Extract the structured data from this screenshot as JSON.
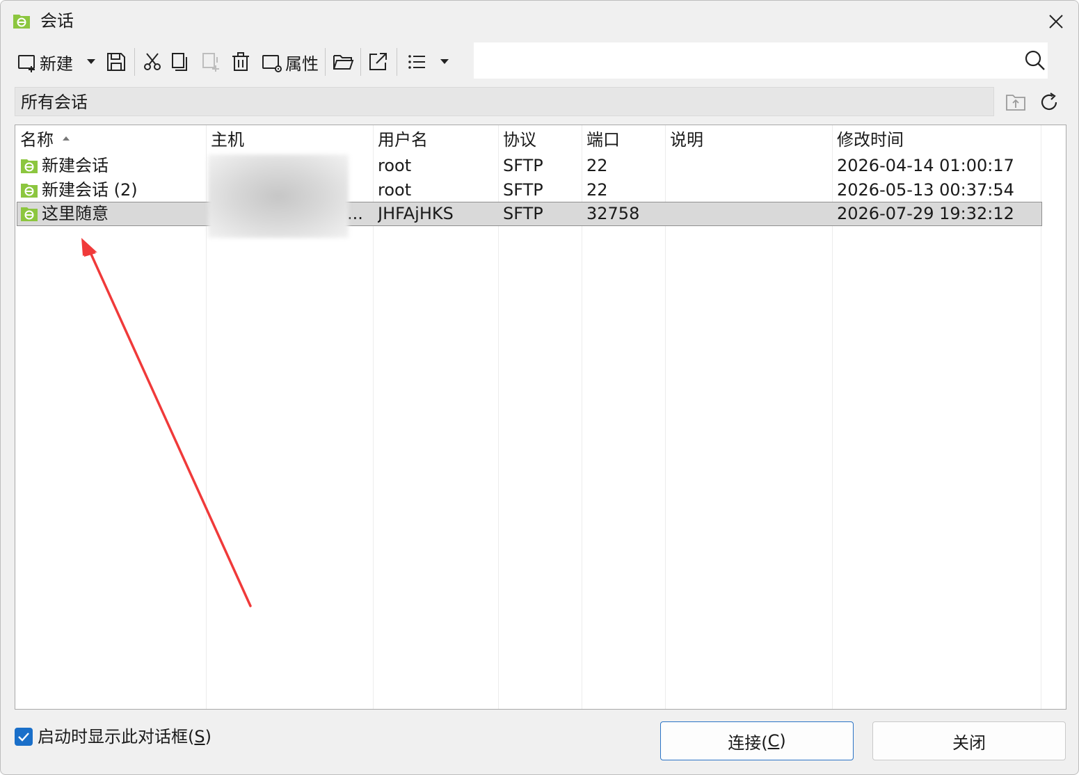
{
  "window": {
    "title": "会话"
  },
  "toolbar": {
    "new_label": "新建",
    "properties_label": "属性",
    "search_value": ""
  },
  "path": {
    "label": "所有会话"
  },
  "table": {
    "columns": [
      "名称",
      "主机",
      "用户名",
      "协议",
      "端口",
      "说明",
      "修改时间"
    ],
    "rows": [
      {
        "name": "新建会话",
        "host": "",
        "user": "root",
        "protocol": "SFTP",
        "port": "22",
        "desc": "",
        "modified": "2026-04-14 01:00:17"
      },
      {
        "name": "新建会话 (2)",
        "host": "",
        "user": "root",
        "protocol": "SFTP",
        "port": "22",
        "desc": "",
        "modified": "2026-05-13 00:37:54"
      },
      {
        "name": "这里随意",
        "host": "...",
        "user": "JHFAjHKS",
        "protocol": "SFTP",
        "port": "32758",
        "desc": "",
        "modified": "2026-07-29 19:32:12",
        "selected": true
      }
    ]
  },
  "footer": {
    "show_on_startup_label": "启动时显示此对话框(",
    "show_on_startup_key": "S",
    "show_on_startup_close": ")",
    "show_on_startup_checked": true,
    "connect_label": "连接(",
    "connect_key": "C",
    "connect_close": ")",
    "close_label": "关闭"
  },
  "colors": {
    "app_green": "#8cc63f",
    "selection": "#d9d9d9",
    "checkbox_blue": "#1a6fc9",
    "arrow_red": "#f03a3a"
  }
}
